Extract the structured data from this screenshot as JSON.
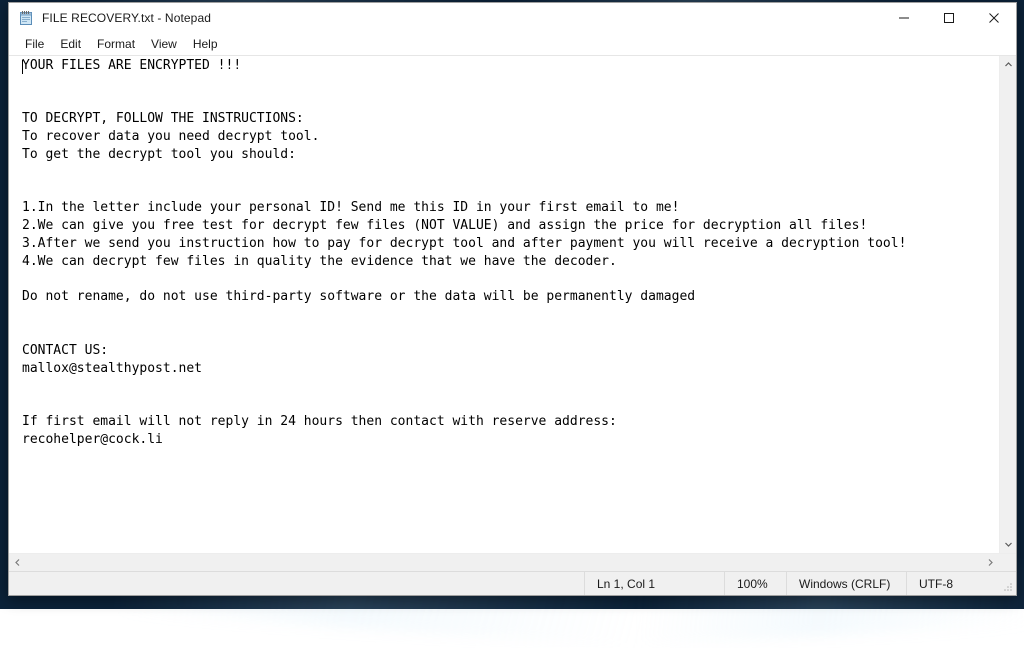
{
  "window": {
    "title": "FILE RECOVERY.txt - Notepad",
    "icon": "notepad-icon",
    "controls": {
      "minimize": {
        "name": "minimize-button",
        "glyph": "–"
      },
      "maximize": {
        "name": "maximize-button",
        "glyph": "□"
      },
      "close": {
        "name": "close-button",
        "glyph": "✕"
      }
    }
  },
  "menu": {
    "items": [
      {
        "label": "File"
      },
      {
        "label": "Edit"
      },
      {
        "label": "Format"
      },
      {
        "label": "View"
      },
      {
        "label": "Help"
      }
    ]
  },
  "document": {
    "body": "YOUR FILES ARE ENCRYPTED !!!\n\n\nTO DECRYPT, FOLLOW THE INSTRUCTIONS:\nTo recover data you need decrypt tool.\nTo get the decrypt tool you should:\n\n\n1.In the letter include your personal ID! Send me this ID in your first email to me!\n2.We can give you free test for decrypt few files (NOT VALUE) and assign the price for decryption all files!\n3.After we send you instruction how to pay for decrypt tool and after payment you will receive a decryption tool!\n4.We can decrypt few files in quality the evidence that we have the decoder.\n\nDo not rename, do not use third-party software or the data will be permanently damaged\n\n\nCONTACT US:\nmallox@stealthypost.net\n\n\nIf first email will not reply in 24 hours then contact with reserve address:\nrecohelper@cock.li"
  },
  "scrollbars": {
    "vertical": {
      "up_glyph": "⌃",
      "down_glyph": "⌄"
    },
    "horizontal": {
      "left_glyph": "‹",
      "right_glyph": "›"
    }
  },
  "status_bar": {
    "cursor_position": "Ln 1, Col 1",
    "zoom": "100%",
    "line_ending": "Windows (CRLF)",
    "encoding": "UTF-8"
  },
  "colors": {
    "window_background": "#ffffff",
    "status_background": "#f0f0f0",
    "text": "#000000",
    "close_hover": "#e81123",
    "desktop": "#0b2239"
  }
}
